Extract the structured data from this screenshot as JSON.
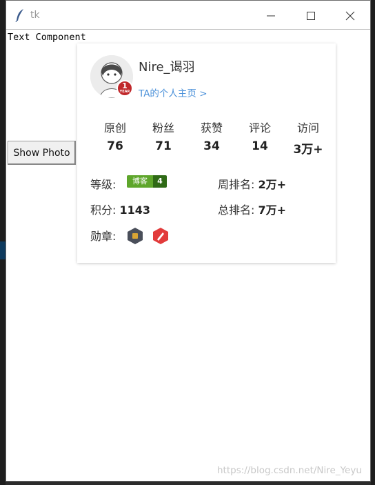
{
  "window": {
    "title": "tk"
  },
  "text_component": "Text Component",
  "show_button": "Show Photo",
  "profile": {
    "username": "Nire_谒羽",
    "homepage_link": "TA的个人主页 >",
    "avatar_badge": {
      "number": "1",
      "caption": "YEAR"
    },
    "stats": [
      {
        "label": "原创",
        "value": "76"
      },
      {
        "label": "粉丝",
        "value": "71"
      },
      {
        "label": "获赞",
        "value": "34"
      },
      {
        "label": "评论",
        "value": "14"
      },
      {
        "label": "访问",
        "value": "3万+"
      }
    ],
    "level_label": "等级:",
    "level_badge_text": "博客",
    "level_badge_num": "4",
    "weekly_rank_label": "周排名:",
    "weekly_rank_value": "2万+",
    "points_label": "积分:",
    "points_value": "1143",
    "total_rank_label": "总排名:",
    "total_rank_value": "7万+",
    "medals_label": "勋章:"
  },
  "watermark": "https://blog.csdn.net/Nire_Yeyu"
}
